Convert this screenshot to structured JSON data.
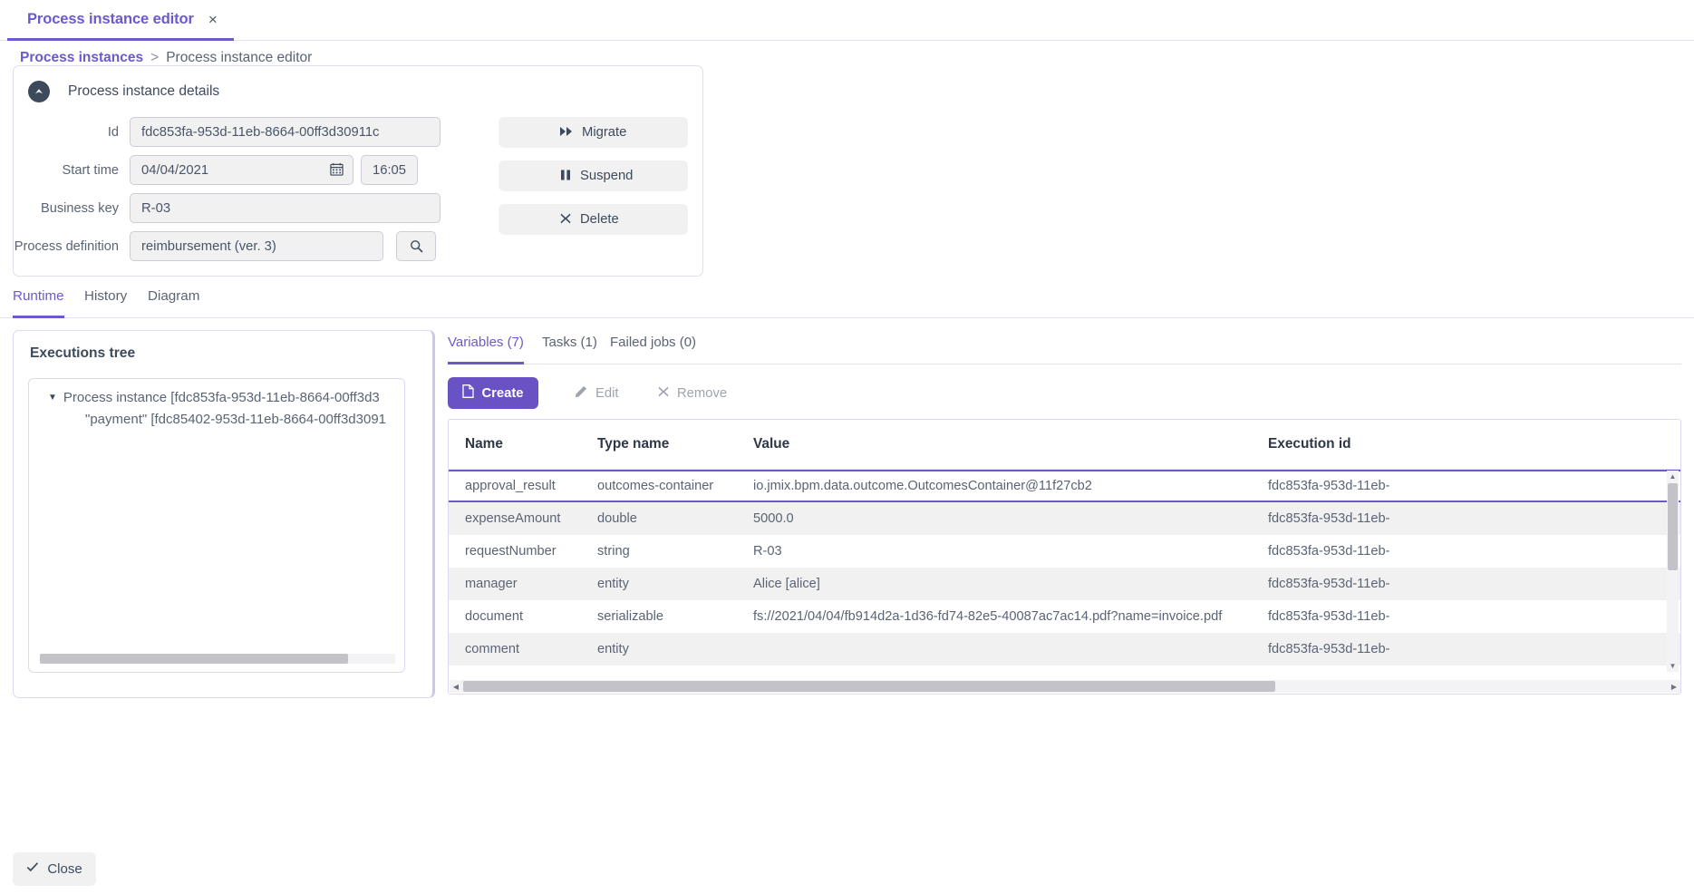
{
  "window": {
    "tab_label": "Process instance editor",
    "tab_close": "×"
  },
  "breadcrumb": {
    "parent": "Process instances",
    "separator": ">",
    "current": "Process instance editor"
  },
  "details": {
    "title": "Process instance details",
    "fields": {
      "id_label": "Id",
      "id_value": "fdc853fa-953d-11eb-8664-00ff3d30911c",
      "start_time_label": "Start time",
      "start_date_value": "04/04/2021",
      "start_time_value": "16:05",
      "business_key_label": "Business key",
      "business_key_value": "R-03",
      "process_definition_label": "Process definition",
      "process_definition_value": "reimbursement (ver. 3)"
    },
    "actions": {
      "migrate": "Migrate",
      "suspend": "Suspend",
      "delete": "Delete"
    }
  },
  "section_tabs": [
    {
      "label": "Runtime",
      "active": true
    },
    {
      "label": "History",
      "active": false
    },
    {
      "label": "Diagram",
      "active": false
    }
  ],
  "executions": {
    "title": "Executions tree",
    "nodes": [
      {
        "label": "Process instance [fdc853fa-953d-11eb-8664-00ff3d3",
        "level": 0
      },
      {
        "label": "\"payment\" [fdc85402-953d-11eb-8664-00ff3d3091",
        "level": 1
      }
    ]
  },
  "variables_panel": {
    "tabs": [
      {
        "label": "Variables (7)",
        "active": true
      },
      {
        "label": "Tasks (1)",
        "active": false
      },
      {
        "label": "Failed jobs (0)",
        "active": false
      }
    ],
    "toolbar": {
      "create": "Create",
      "edit": "Edit",
      "remove": "Remove"
    },
    "columns": [
      "Name",
      "Type name",
      "Value",
      "Execution id"
    ],
    "rows": [
      {
        "name": "approval_result",
        "type": "outcomes-container",
        "value": "io.jmix.bpm.data.outcome.OutcomesContainer@11f27cb2",
        "execution_id": "fdc853fa-953d-11eb-",
        "selected": true
      },
      {
        "name": "expenseAmount",
        "type": "double",
        "value": "5000.0",
        "execution_id": "fdc853fa-953d-11eb-",
        "selected": false
      },
      {
        "name": "requestNumber",
        "type": "string",
        "value": "R-03",
        "execution_id": "fdc853fa-953d-11eb-",
        "selected": false
      },
      {
        "name": "manager",
        "type": "entity",
        "value": "Alice [alice]",
        "execution_id": "fdc853fa-953d-11eb-",
        "selected": false
      },
      {
        "name": "document",
        "type": "serializable",
        "value": "fs://2021/04/04/fb914d2a-1d36-fd74-82e5-40087ac7ac14.pdf?name=invoice.pdf",
        "execution_id": "fdc853fa-953d-11eb-",
        "selected": false
      },
      {
        "name": "comment",
        "type": "entity",
        "value": "",
        "execution_id": "fdc853fa-953d-11eb-",
        "selected": false
      }
    ]
  },
  "footer": {
    "close": "Close"
  },
  "colors": {
    "accent": "#6a5acd",
    "primary_button": "#6a52c4",
    "field_bg": "#f1f1f2",
    "text": "#5a6474"
  }
}
